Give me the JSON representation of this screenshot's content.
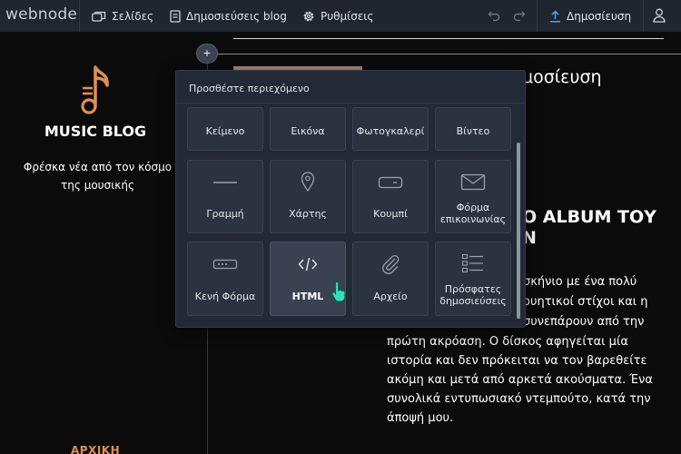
{
  "app": {
    "logo": "webnode",
    "nav": {
      "pages": "Σελίδες",
      "blog_posts": "Δημοσιεύσεις blog",
      "settings": "Ρυθμίσεις"
    },
    "publish": "Δημοσίευση",
    "icons": [
      "pages-icon",
      "document-icon",
      "gear-icon",
      "undo-icon",
      "redo-icon",
      "upload-icon",
      "user-icon"
    ]
  },
  "sidebar": {
    "title": "MUSIC BLOG",
    "subtitle_line1": "Φρέσκα νέα από τον κόσμο",
    "subtitle_line2": "της μουσικής",
    "home_link": "ΑΡΧΙΚΗ",
    "accent_color": "#e0904e"
  },
  "content": {
    "plus_label": "+",
    "post_heading_fragment": "μοσίευση",
    "album_title_line1": "Ο ALBUM ΤΟΥ",
    "album_title_line2": "Ν",
    "paragraph_lines": [
      "σκήνιο με ένα πολύ",
      "ουητικοί στίχοι και η",
      "συνεπάρουν από την",
      "πρώτη ακρόαση. Ο δίσκος αφηγείται μία",
      "ιστορία και δεν πρόκειται να τον βαρεθείτε",
      "ακόμη και μετά από αρκετά ακούσματα. Ένα",
      "συνολικά εντυπωσιακό ντεμπούτο, κατά την",
      "άποψή μου."
    ]
  },
  "panel": {
    "header": "Προσθέστε περιεχόμενο",
    "row1": [
      "Κείμενο",
      "Εικόνα",
      "Φωτογκαλερί",
      "Βίντεο"
    ],
    "row2": {
      "line": "Γραμμή",
      "map": "Χάρτης",
      "button": "Κουμπί",
      "contact_l1": "Φόρμα",
      "contact_l2": "επικοινωνίας"
    },
    "row3": {
      "blank_form": "Κενή Φόρμα",
      "html": "HTML",
      "file": "Αρχείο",
      "recent_l1": "Πρόσφατες",
      "recent_l2": "δημοσιεύσεις"
    }
  }
}
